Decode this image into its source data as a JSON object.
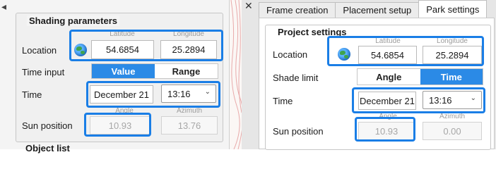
{
  "left_panel": {
    "arrow": "◂",
    "group_title": "Shading parameters",
    "location_label": "Location",
    "latitude_caption": "Latitude",
    "longitude_caption": "Longitude",
    "latitude_value": "54.6854",
    "longitude_value": "25.2894",
    "time_input_label": "Time input",
    "toggle_value": "Value",
    "toggle_range": "Range",
    "time_label": "Time",
    "date_value": "December 21",
    "time_value": "13:16",
    "sun_position_label": "Sun position",
    "angle_caption": "Angle",
    "azimuth_caption": "Azimuth",
    "angle_value": "10.93",
    "azimuth_value": "13.76",
    "next_section_title": "Object list"
  },
  "right_panel": {
    "close": "✕",
    "tabs": [
      {
        "label": "Frame creation"
      },
      {
        "label": "Placement setup"
      },
      {
        "label": "Park settings"
      }
    ],
    "group_title": "Project settings",
    "location_label": "Location",
    "latitude_caption": "Latitude",
    "longitude_caption": "Longitude",
    "latitude_value": "54.6854",
    "longitude_value": "25.2894",
    "shade_limit_label": "Shade limit",
    "toggle_angle": "Angle",
    "toggle_time": "Time",
    "time_label": "Time",
    "date_value": "December 21",
    "time_value": "13:16",
    "sun_position_label": "Sun position",
    "angle_caption": "Angle",
    "azimuth_caption": "Azimuth",
    "angle_value": "10.93",
    "azimuth_value": "0.00"
  },
  "icons": {
    "globe": "globe-icon",
    "chevron": "chevron-down-icon"
  },
  "colors": {
    "accent": "#2b8ae6",
    "highlight": "#1a7ee6",
    "canvas_contour": "#e8aaaa"
  }
}
